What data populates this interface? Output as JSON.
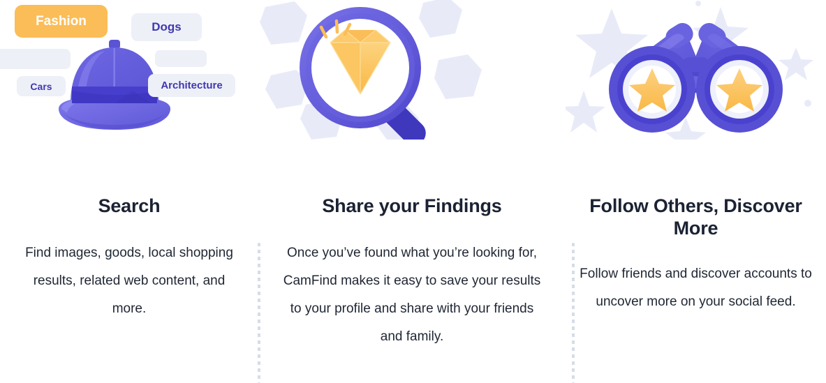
{
  "palette": {
    "page_background": "#ffffff",
    "heading_color": "#1b2233",
    "body_color": "#1f2633",
    "accent_purple": "#5b55d6",
    "accent_purple_dark": "#3f38b0",
    "accent_amber": "#fbbd57",
    "pill_background": "#eef0f8",
    "pill_text": "#3f38b0",
    "fashion_pill_background": "#fbbd57",
    "fashion_pill_text": "#ffffff",
    "decor_lavender": "#e8ebf7",
    "divider_color": "#cfd6e4"
  },
  "columns": [
    {
      "id": "search",
      "illustration": "pith-hat-with-category-tags-illustration",
      "heading": "Search",
      "body": "Find images, goods, local shopping results, related web content, and more.",
      "tags": [
        {
          "label": "Fashion",
          "state": "selected"
        },
        {
          "label": "Dogs",
          "state": "default"
        },
        {
          "label": "",
          "state": "placeholder"
        },
        {
          "label": "",
          "state": "placeholder"
        },
        {
          "label": "Cars",
          "state": "default"
        },
        {
          "label": "Architecture",
          "state": "default"
        }
      ]
    },
    {
      "id": "share",
      "illustration": "magnifying-glass-with-diamond-illustration",
      "heading": "Share your Findings",
      "body": "Once you’ve found what you’re looking for, CamFind makes it easy to save your results to your profile and share with your friends and family."
    },
    {
      "id": "follow",
      "illustration": "binoculars-with-stars-illustration",
      "heading": "Follow Others, Discover More",
      "body": "Follow friends and discover accounts to uncover more on your social feed."
    }
  ],
  "dividers": [
    {
      "id": "divider-between-search-and-share",
      "style": "dotted-vertical"
    },
    {
      "id": "divider-between-share-and-follow",
      "style": "dotted-vertical"
    }
  ]
}
